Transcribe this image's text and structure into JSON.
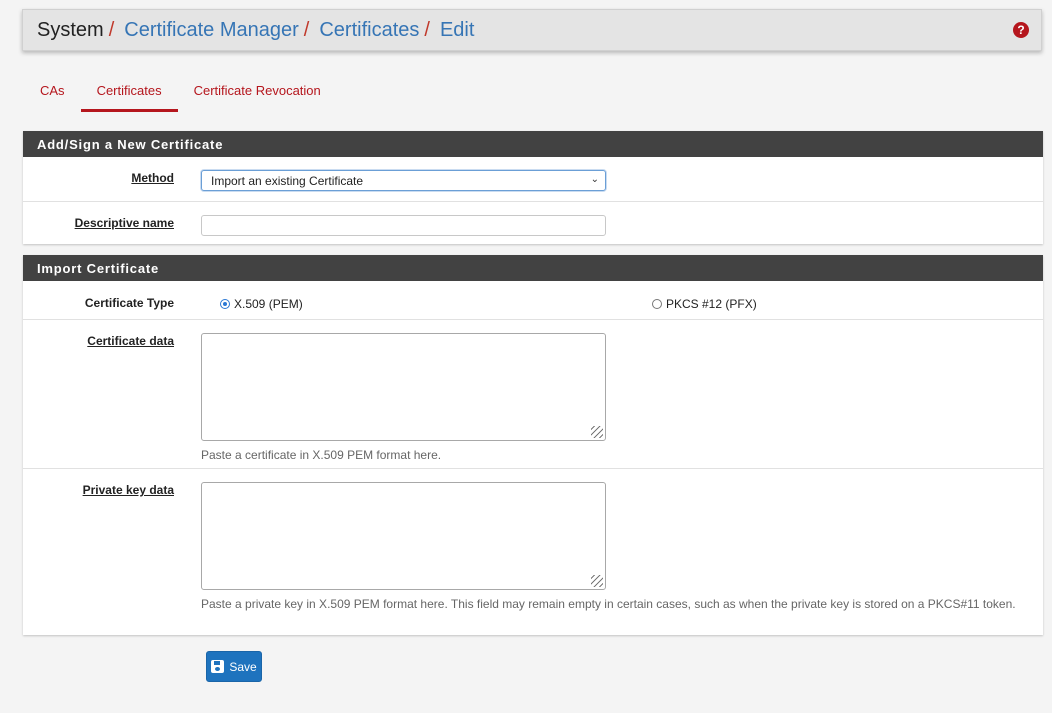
{
  "breadcrumb": {
    "root": "System",
    "separator": "/",
    "items": [
      "Certificate Manager",
      "Certificates",
      "Edit"
    ]
  },
  "help_icon": "question-circle-icon",
  "tabs": [
    {
      "label": "CAs",
      "active": false
    },
    {
      "label": "Certificates",
      "active": true
    },
    {
      "label": "Certificate Revocation",
      "active": false
    }
  ],
  "section_new": {
    "heading": "Add/Sign a New Certificate",
    "method_label": "Method",
    "method_value": "Import an existing Certificate",
    "descr_label": "Descriptive name",
    "descr_value": ""
  },
  "section_import": {
    "heading": "Import Certificate",
    "type_label": "Certificate Type",
    "type_options": [
      {
        "label": "X.509 (PEM)",
        "selected": true
      },
      {
        "label": "PKCS #12 (PFX)",
        "selected": false
      }
    ],
    "cert_label": "Certificate data",
    "cert_help": "Paste a certificate in X.509 PEM format here.",
    "key_label": "Private key data",
    "key_help": "Paste a private key in X.509 PEM format here. This field may remain empty in certain cases, such as when the private key is stored on a PKCS#11 token."
  },
  "save_label": "Save",
  "colors": {
    "accent_red": "#b5161d",
    "link_blue": "#3675b5",
    "heading_dark": "#424242",
    "button_blue": "#1e73be"
  }
}
